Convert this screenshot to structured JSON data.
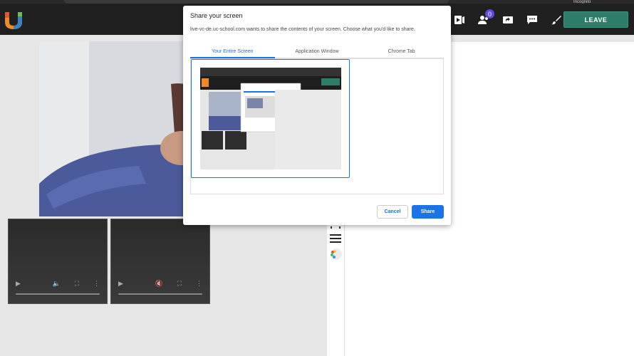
{
  "browser": {
    "profile_label": "Incognito"
  },
  "header": {
    "participants_count": "0",
    "leave_label": "LEAVE"
  },
  "dialog": {
    "title": "Share your screen",
    "description": "live-vc-de.uc-school.com wants to share the contents of your screen. Choose what you'd like to share.",
    "tabs": [
      {
        "label": "Your Entire Screen"
      },
      {
        "label": "Application Window"
      },
      {
        "label": "Chrome Tab"
      }
    ],
    "cancel_label": "Cancel",
    "share_label": "Share"
  },
  "colors": {
    "accent": "#1a73e8",
    "leave": "#2e7d6b",
    "badge": "#5b4be0",
    "header_bg": "#202020"
  }
}
